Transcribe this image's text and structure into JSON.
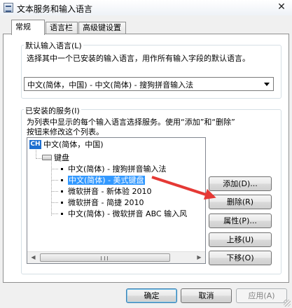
{
  "window": {
    "title": "文本服务和输入语言",
    "close_glyph": "✕"
  },
  "tabs": [
    {
      "label": "常规"
    },
    {
      "label": "语言栏"
    },
    {
      "label": "高级键设置"
    }
  ],
  "default_lang": {
    "legend": "默认输入语言(L)",
    "description": "选择其中一个已安装的输入语言，用作所有输入字段的默认语言。",
    "selected": "中文(简体，中国) - 中文(简体) - 搜狗拼音输入法"
  },
  "installed": {
    "legend": "已安装的服务(I)",
    "description_line1": "为列表中显示的每个输入语言选择服务。使用“添加”和“删除”",
    "description_line2": "按钮来修改这个列表。",
    "tree": {
      "language": {
        "badge": "CH",
        "label": "中文(简体，中国)"
      },
      "category": "键盘",
      "items": [
        {
          "label": "中文(简体) - 搜狗拼音输入法",
          "selected": false
        },
        {
          "label": "中文(简体) - 美式键盘",
          "selected": true
        },
        {
          "label": "微软拼音 - 新体验 2010",
          "selected": false
        },
        {
          "label": "微软拼音 - 简捷 2010",
          "selected": false
        },
        {
          "label": "中文(简体) - 微软拼音 ABC 输入风",
          "selected": false
        }
      ]
    },
    "buttons": {
      "add": "添加(D)...",
      "remove": "删除(R)",
      "properties": "属性(P)...",
      "move_up": "上移(U)",
      "move_down": "下移(O)"
    }
  },
  "footer": {
    "ok": "确定",
    "cancel": "取消",
    "apply": "应用(A)"
  },
  "colors": {
    "selection": "#3399ff",
    "annotation_arrow": "#e53935",
    "lang_badge": "#1e6fd0"
  }
}
